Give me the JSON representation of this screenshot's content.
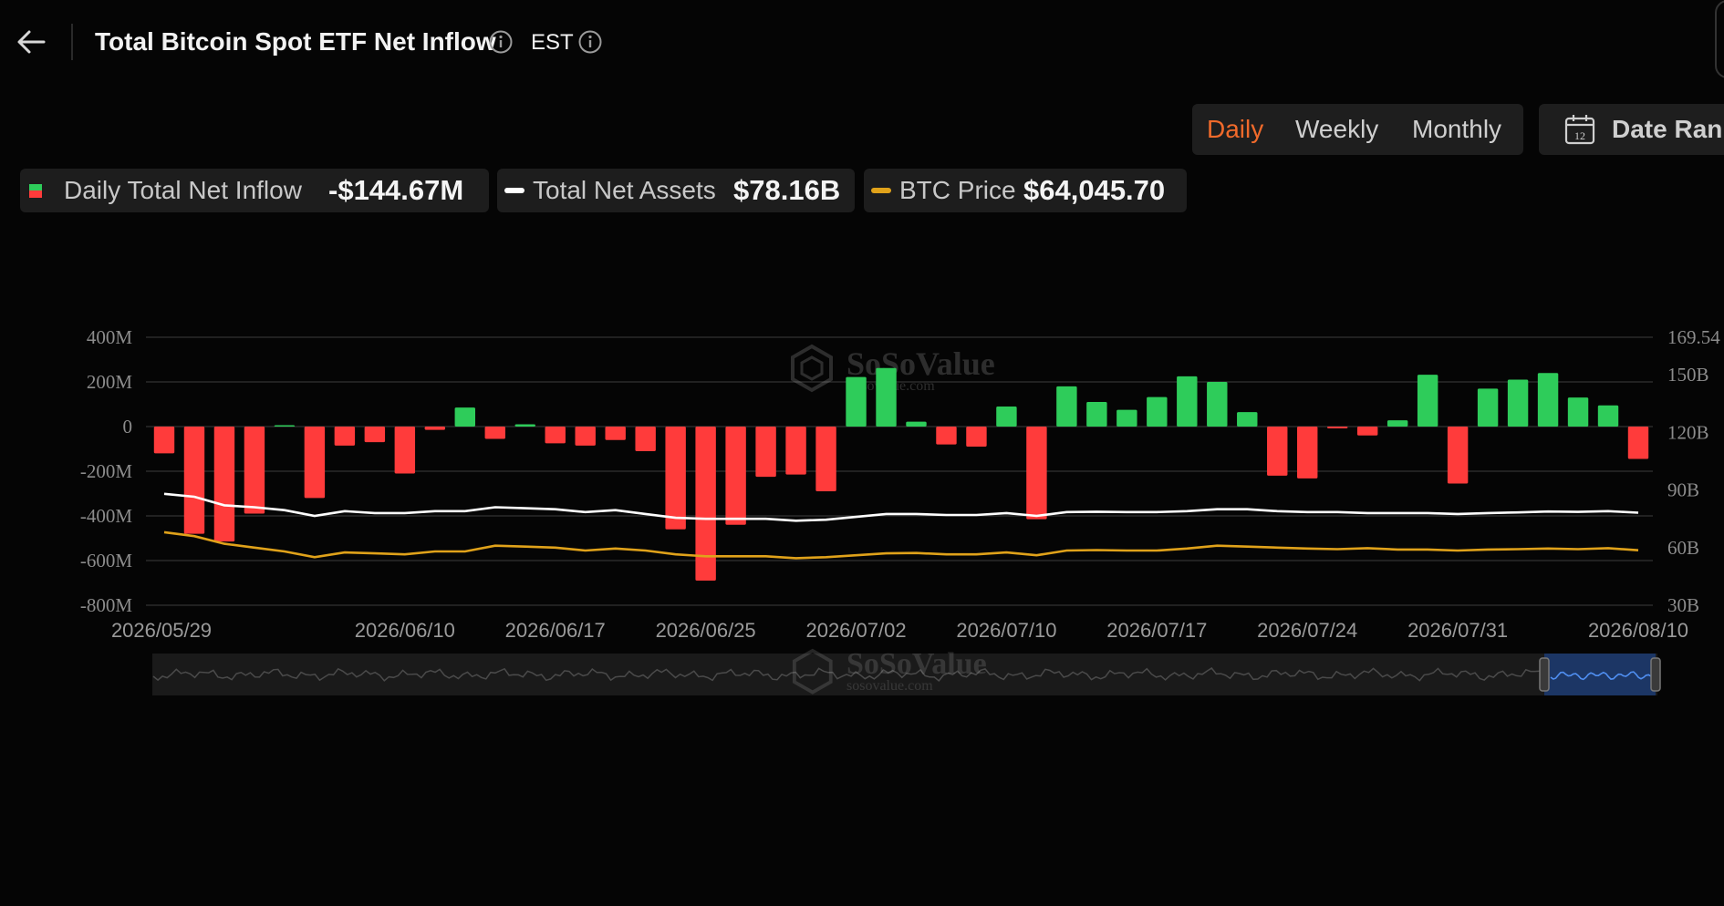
{
  "header": {
    "title": "Total Bitcoin Spot ETF Net Inflow",
    "timezone": "EST"
  },
  "periods": {
    "daily": "Daily",
    "weekly": "Weekly",
    "monthly": "Monthly",
    "active": "Daily"
  },
  "date_range_label": "Date Ran",
  "date_range_icon_day": "12",
  "legend": {
    "inflow": {
      "label": "Daily Total Net Inflow",
      "value": "-$144.67M"
    },
    "assets": {
      "label": "Total Net Assets",
      "value": "$78.16B"
    },
    "btc": {
      "label": "BTC Price",
      "value": "$64,045.70"
    }
  },
  "watermark": {
    "brand": "SoSoValue",
    "url": "sosovalue.com"
  },
  "colors": {
    "positive": "#2ecc5a",
    "negative": "#ff3b3b",
    "assets_line": "#ffffff",
    "btc_line": "#e0a21a",
    "accent": "#f06a2b",
    "navigator_window": "#1d3a6e"
  },
  "chart_data": {
    "type": "bar",
    "title": "Total Bitcoin Spot ETF Net Inflow",
    "left_axis": {
      "ticks": [
        "400M",
        "200M",
        "0",
        "-200M",
        "-400M",
        "-600M",
        "-800M"
      ],
      "ylim": [
        -800,
        400
      ],
      "unit": "M"
    },
    "right_axis": {
      "ticks": [
        "169.54",
        "150B",
        "120B",
        "90B",
        "60B",
        "30B"
      ],
      "ylim": [
        30,
        169.54
      ],
      "unit": "B"
    },
    "x_tick_labels": [
      "2026/05/29",
      "2026/06/10",
      "2026/06/17",
      "2026/06/25",
      "2026/07/02",
      "2026/07/10",
      "2026/07/17",
      "2026/07/24",
      "2026/07/31",
      "2026/08/10"
    ],
    "x_tick_indices": [
      0,
      8,
      13,
      18,
      23,
      28,
      33,
      38,
      43,
      49
    ],
    "grid": true,
    "series": [
      {
        "name": "Daily Total Net Inflow",
        "kind": "bar",
        "values": [
          -120,
          -480,
          -515,
          -390,
          3,
          -320,
          -85,
          -70,
          -210,
          -15,
          85,
          -55,
          10,
          -75,
          -85,
          -60,
          -110,
          -460,
          -690,
          -440,
          -225,
          -215,
          -290,
          222,
          262,
          22,
          -80,
          -90,
          90,
          -415,
          180,
          110,
          75,
          132,
          225,
          200,
          65,
          -220,
          -232,
          -8,
          -40,
          28,
          232,
          -255,
          170,
          210,
          240,
          130,
          95,
          -144.67
        ]
      },
      {
        "name": "Total Net Assets",
        "kind": "line",
        "values": [
          88,
          86.5,
          82,
          81,
          79.5,
          76.5,
          79,
          78,
          78,
          79,
          79,
          81,
          80.5,
          80,
          78.5,
          79.5,
          77.5,
          75.5,
          75,
          75,
          75,
          74,
          74.5,
          76,
          77.5,
          77.5,
          77,
          77,
          78,
          76.5,
          78.5,
          78.7,
          78.5,
          78.5,
          79,
          80,
          80,
          79,
          78.5,
          78.5,
          78,
          78,
          78,
          77.5,
          78,
          78.3,
          78.8,
          78.6,
          79,
          78.16
        ]
      },
      {
        "name": "BTC Price",
        "kind": "line",
        "values": [
          68,
          66,
          62,
          60,
          58,
          55,
          57.5,
          57,
          56.5,
          58,
          58,
          61,
          60.5,
          60,
          58.5,
          59.5,
          58.5,
          56.5,
          55.5,
          55.5,
          55.5,
          54.5,
          55,
          56,
          57,
          57.2,
          56.5,
          56.5,
          57.5,
          56,
          58.5,
          58.7,
          58.5,
          58.5,
          59.5,
          61,
          60.5,
          60,
          59.5,
          59.2,
          59.7,
          59,
          59,
          58.5,
          59,
          59.2,
          59.5,
          59.2,
          59.7,
          58.6
        ]
      }
    ]
  }
}
